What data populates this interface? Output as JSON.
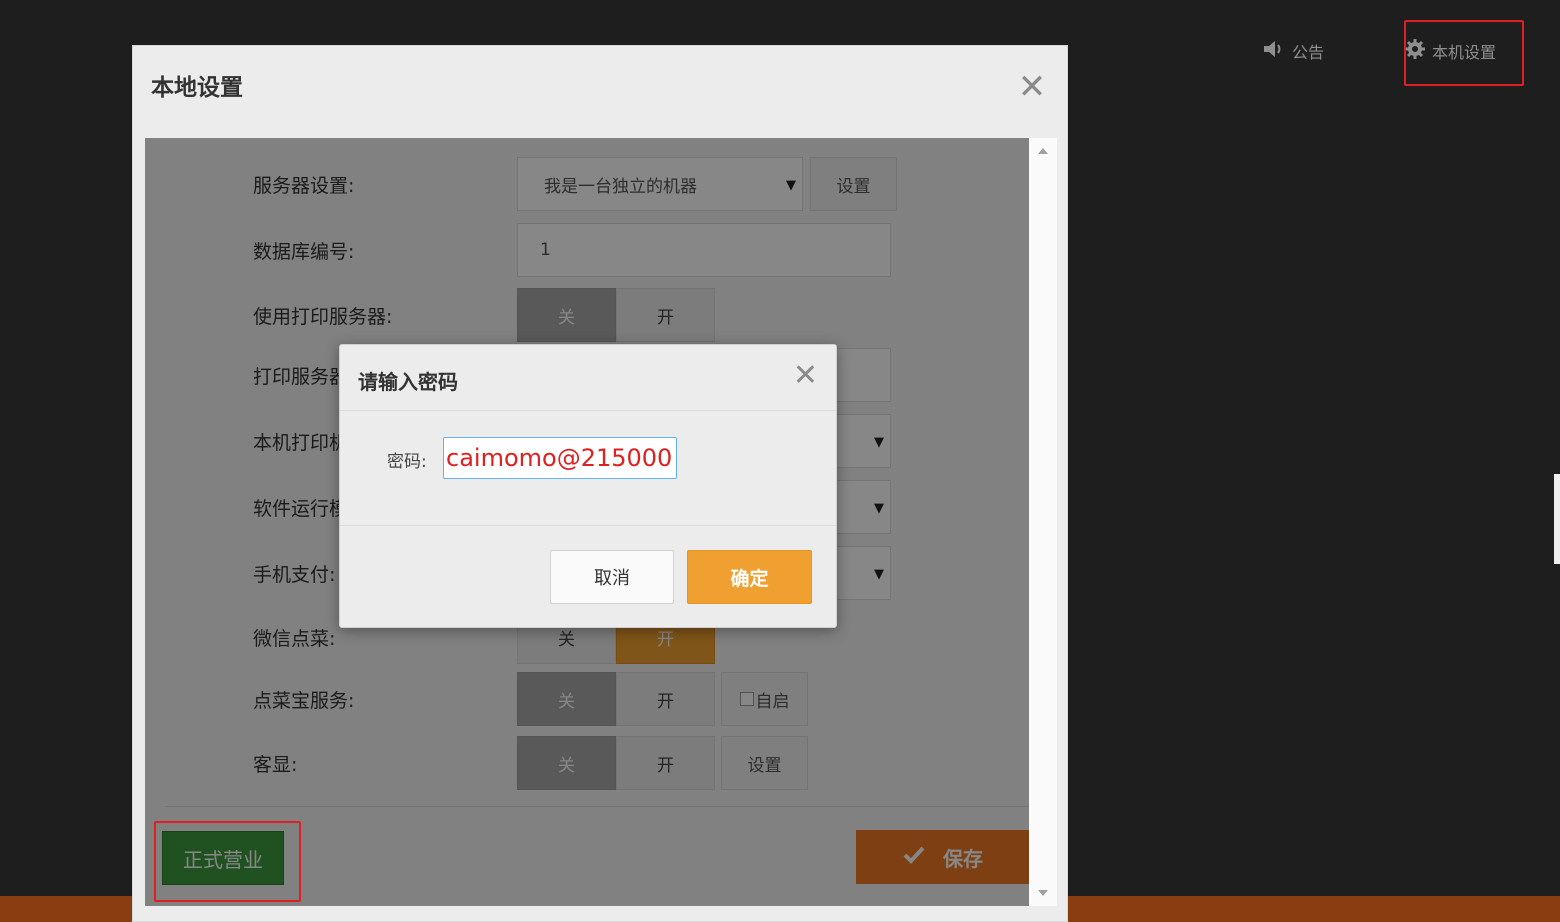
{
  "topbar": {
    "notice_label": "公告",
    "settings_label": "本机设置",
    "notice_icon": "speaker-icon",
    "settings_icon": "gear-icon"
  },
  "settings_modal": {
    "title": "本地设置",
    "close_icon": "close-icon",
    "rows": [
      {
        "label": "服务器设置:",
        "select_value": "我是一台独立的机器",
        "button": "设置"
      },
      {
        "label": "数据库编号:",
        "input_value": "1"
      },
      {
        "label": "使用打印服务器:",
        "off": "关",
        "on": "开"
      },
      {
        "label": "打印服务器"
      },
      {
        "label": "本机打印机"
      },
      {
        "label": "软件运行模"
      },
      {
        "label": "手机支付:"
      },
      {
        "label": "微信点菜:",
        "off": "关",
        "on": "开"
      },
      {
        "label": "点菜宝服务:",
        "off": "关",
        "on": "开",
        "checkbox_label": "自启"
      },
      {
        "label": "客显:",
        "off": "关",
        "on": "开",
        "button": "设置"
      }
    ],
    "footer": {
      "open_button": "正式营业",
      "save_button": "保存",
      "save_icon": "check-icon"
    }
  },
  "password_dialog": {
    "title": "请输入密码",
    "label": "密码:",
    "value": "caimomo@215000",
    "cancel": "取消",
    "confirm": "确定"
  },
  "colors": {
    "background": "#1e1e1e",
    "highlight": "#e02020",
    "accent_orange": "#f0a030",
    "save_orange": "#ee7a25",
    "open_green": "#3e9a3e",
    "password_text": "#e02020"
  }
}
